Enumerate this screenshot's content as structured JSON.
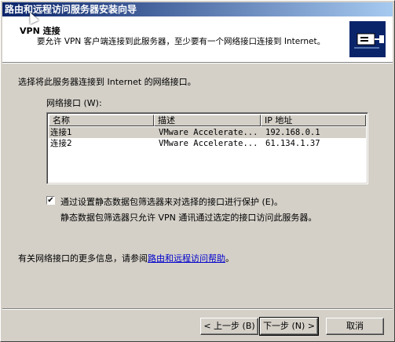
{
  "window": {
    "title": "路由和远程访问服务器安装向导"
  },
  "header": {
    "title": "VPN 连接",
    "description": "要允许 VPN 客户端连接到此服务器，至少要有一个网络接口连接到 Internet。"
  },
  "intro_text": "选择将此服务器连接到 Internet 的网络接口。",
  "interfaces": {
    "label": "网络接口 (W):",
    "columns": [
      "名称",
      "描述",
      "IP 地址"
    ],
    "rows": [
      {
        "name": "连接1",
        "description": "VMware Accelerate...",
        "ip": "192.168.0.1",
        "selected": true
      },
      {
        "name": "连接2",
        "description": "VMware Accelerate...",
        "ip": "61.134.1.37",
        "selected": false
      }
    ]
  },
  "protection": {
    "checked": true,
    "label": "通过设置静态数据包筛选器来对选择的接口进行保护 (E)。",
    "description": "静态数据包筛选器只允许 VPN 通讯通过选定的接口访问此服务器。"
  },
  "help": {
    "prefix": "有关网络接口的更多信息，请参阅",
    "link": "路由和远程访问帮助",
    "suffix": "。"
  },
  "buttons": {
    "back": "< 上一步 (B)",
    "next": "下一步 (N) >",
    "cancel": "取消"
  },
  "icons": {
    "header_icon": "network-server-icon",
    "cursor": "mouse-pointer-icon"
  }
}
